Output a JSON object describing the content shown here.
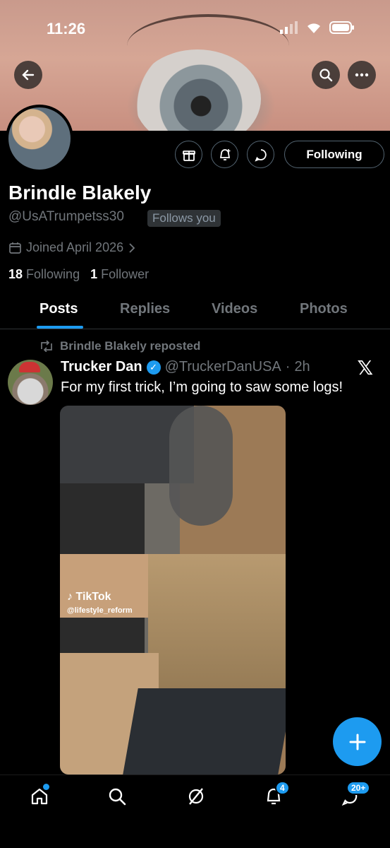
{
  "status_bar": {
    "time": "11:26"
  },
  "banner": {
    "back_icon": "arrow-left-icon",
    "search_icon": "search-icon",
    "more_icon": "more-icon"
  },
  "profile": {
    "display_name": "Brindle Blakely",
    "handle": "@UsATrumpetss30",
    "follows_you": "Follows you",
    "joined": "Joined April 2026",
    "following_count": "18",
    "following_label": "Following",
    "follower_count": "1",
    "follower_label": "Follower",
    "following_button": "Following"
  },
  "tabs": [
    "Posts",
    "Replies",
    "Videos",
    "Photos"
  ],
  "post": {
    "repost_label": "Brindle Blakely reposted",
    "author_name": "Trucker Dan",
    "author_handle": "@TruckerDanUSA",
    "time": "2h",
    "text": "For my first trick, I’m going to saw some logs!",
    "media_watermark": "TikTok",
    "media_watermark_handle": "@lifestyle_reform"
  },
  "bottom_nav": {
    "notifications_badge": "4",
    "messages_badge": "20+"
  },
  "colors": {
    "accent": "#1d9bf0",
    "background": "#000000",
    "muted": "#71767b"
  }
}
